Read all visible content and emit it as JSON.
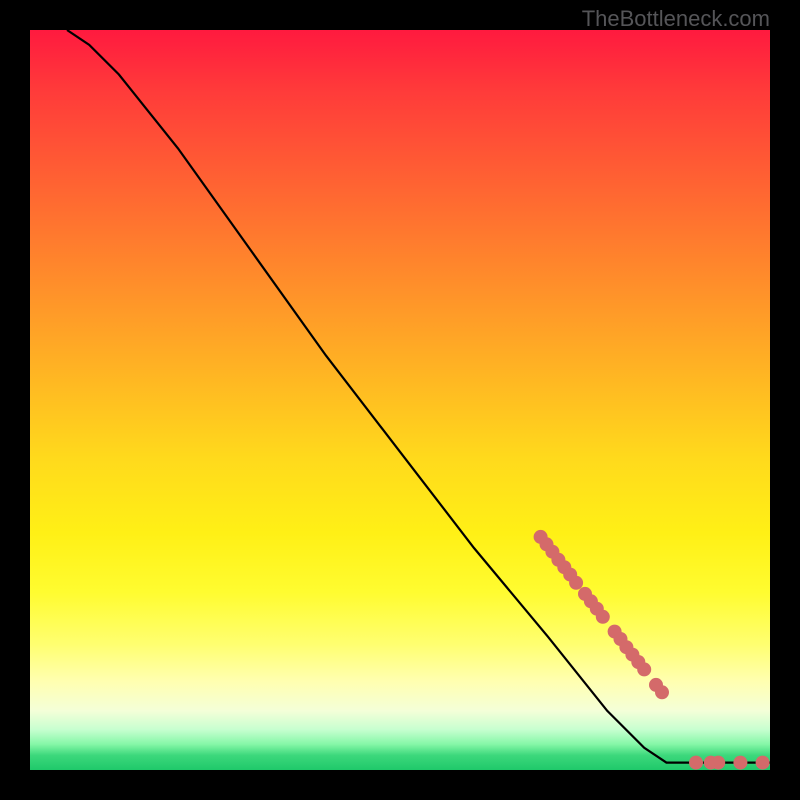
{
  "attribution": "TheBottleneck.com",
  "chart_data": {
    "type": "line",
    "title": "",
    "xlabel": "",
    "ylabel": "",
    "xlim": [
      0,
      100
    ],
    "ylim": [
      0,
      100
    ],
    "curve": [
      {
        "x": 5,
        "y": 100
      },
      {
        "x": 8,
        "y": 98
      },
      {
        "x": 12,
        "y": 94
      },
      {
        "x": 16,
        "y": 89
      },
      {
        "x": 20,
        "y": 84
      },
      {
        "x": 30,
        "y": 70
      },
      {
        "x": 40,
        "y": 56
      },
      {
        "x": 50,
        "y": 43
      },
      {
        "x": 60,
        "y": 30
      },
      {
        "x": 70,
        "y": 18
      },
      {
        "x": 78,
        "y": 8
      },
      {
        "x": 83,
        "y": 3
      },
      {
        "x": 86,
        "y": 1
      },
      {
        "x": 90,
        "y": 1
      },
      {
        "x": 95,
        "y": 1
      },
      {
        "x": 100,
        "y": 1
      }
    ],
    "markers": [
      {
        "x": 69.0,
        "y": 31.5
      },
      {
        "x": 69.8,
        "y": 30.5
      },
      {
        "x": 70.6,
        "y": 29.5
      },
      {
        "x": 71.4,
        "y": 28.4
      },
      {
        "x": 72.2,
        "y": 27.4
      },
      {
        "x": 73.0,
        "y": 26.4
      },
      {
        "x": 73.8,
        "y": 25.3
      },
      {
        "x": 75.0,
        "y": 23.8
      },
      {
        "x": 75.8,
        "y": 22.8
      },
      {
        "x": 76.6,
        "y": 21.8
      },
      {
        "x": 77.4,
        "y": 20.7
      },
      {
        "x": 79.0,
        "y": 18.7
      },
      {
        "x": 79.8,
        "y": 17.7
      },
      {
        "x": 80.6,
        "y": 16.6
      },
      {
        "x": 81.4,
        "y": 15.6
      },
      {
        "x": 82.2,
        "y": 14.6
      },
      {
        "x": 83.0,
        "y": 13.6
      },
      {
        "x": 84.6,
        "y": 11.5
      },
      {
        "x": 85.4,
        "y": 10.5
      },
      {
        "x": 90.0,
        "y": 1.0
      },
      {
        "x": 92.0,
        "y": 1.0
      },
      {
        "x": 93.0,
        "y": 1.0
      },
      {
        "x": 96.0,
        "y": 1.0
      },
      {
        "x": 99.0,
        "y": 1.0
      }
    ],
    "marker_color": "#d46a6a",
    "line_color": "#000000"
  }
}
